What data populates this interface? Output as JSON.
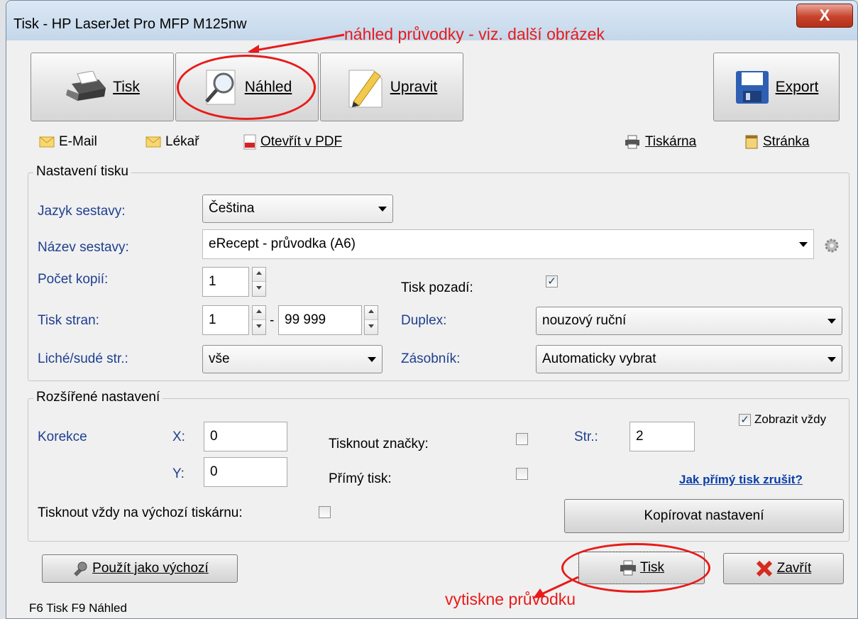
{
  "window": {
    "title": "Tisk - HP LaserJet Pro MFP M125nw",
    "close_label": "X"
  },
  "annotations": {
    "top": "náhled průvodky - viz. další obrázek",
    "bottom": "vytiskne průvodku",
    "color": "#e81a1a"
  },
  "toolbar": {
    "print": {
      "label": "Tisk",
      "icon": "printer-icon"
    },
    "preview": {
      "label": "Náhled",
      "icon": "magnifier-icon"
    },
    "edit": {
      "label": "Upravit",
      "icon": "pencil-icon"
    },
    "export": {
      "label": "Export",
      "icon": "floppy-disk-icon"
    }
  },
  "links": {
    "email": "E-Mail",
    "doctor": "Lékař",
    "open_pdf": "Otevřít v PDF",
    "printer": "Tiskárna",
    "page": "Stránka"
  },
  "print_settings": {
    "group_title": "Nastavení tisku",
    "language_label": "Jazyk sestavy:",
    "language_value": "Čeština",
    "report_label": "Název sestavy:",
    "report_value": "eRecept - průvodka (A6)",
    "copies_label": "Počet kopií:",
    "copies_value": "1",
    "background_label": "Tisk pozadí:",
    "background_checked": true,
    "pages_label": "Tisk stran:",
    "pages_from": "1",
    "pages_dash": "-",
    "pages_to": "99 999",
    "duplex_label": "Duplex:",
    "duplex_value": "nouzový ruční",
    "odd_even_label": "Liché/sudé str.:",
    "odd_even_value": "vše",
    "tray_label": "Zásobník:",
    "tray_value": "Automaticky vybrat"
  },
  "advanced": {
    "group_title": "Rozšířené nastavení",
    "show_always_label": "Zobrazit vždy",
    "show_always_checked": true,
    "correction_label": "Korekce",
    "x_label": "X:",
    "x_value": "0",
    "y_label": "Y:",
    "y_value": "0",
    "marks_label": "Tisknout značky:",
    "marks_checked": false,
    "direct_label": "Přímý tisk:",
    "direct_checked": false,
    "page_label": "Str.:",
    "page_value": "2",
    "cancel_direct_link": "Jak přímý tisk zrušit?",
    "default_printer_label": "Tisknout vždy na výchozí tiskárnu:",
    "default_printer_checked": false,
    "copy_settings_button": "Kopírovat nastavení"
  },
  "footer": {
    "use_default_button": "Použít jako výchozí",
    "print_button": "Tisk",
    "close_button": "Zavřít",
    "status_text": "F6 Tisk   F9 Náhled"
  }
}
